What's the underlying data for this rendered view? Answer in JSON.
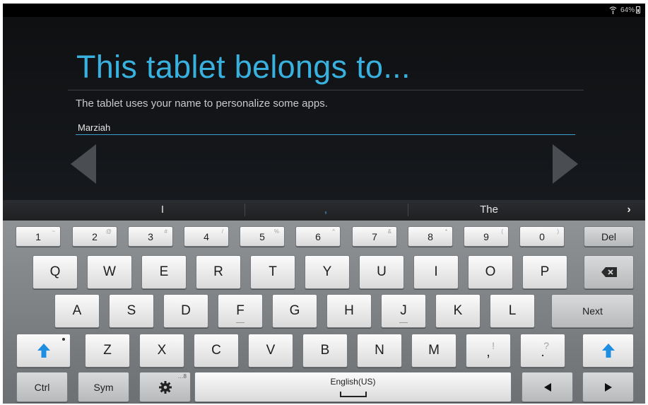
{
  "status_bar": {
    "battery_text": "64%",
    "signal_icon": "wifi-icon",
    "battery_icon": "battery-icon"
  },
  "setup": {
    "title": "This tablet belongs to...",
    "subtitle": "The tablet uses your name to personalize some apps.",
    "name_value": "Marziah",
    "prev_icon": "triangle-left-icon",
    "next_icon": "triangle-right-icon"
  },
  "suggestions": {
    "items": [
      "I",
      ",",
      "The"
    ],
    "more_label": "›"
  },
  "keyboard": {
    "row_numbers": [
      {
        "main": "1",
        "alt": "~"
      },
      {
        "main": "2",
        "alt": "@"
      },
      {
        "main": "3",
        "alt": "#"
      },
      {
        "main": "4",
        "alt": "/"
      },
      {
        "main": "5",
        "alt": "%"
      },
      {
        "main": "6",
        "alt": "^"
      },
      {
        "main": "7",
        "alt": "&"
      },
      {
        "main": "8",
        "alt": "*"
      },
      {
        "main": "9",
        "alt": "("
      },
      {
        "main": "0",
        "alt": ")"
      }
    ],
    "del_label": "Del",
    "row1": [
      "Q",
      "W",
      "E",
      "R",
      "T",
      "Y",
      "U",
      "I",
      "O",
      "P"
    ],
    "row2": [
      "A",
      "S",
      "D",
      "F",
      "G",
      "H",
      "J",
      "K",
      "L"
    ],
    "next_label": "Next",
    "row3": [
      "Z",
      "X",
      "C",
      "V",
      "B",
      "N",
      "M"
    ],
    "comma": {
      "main": ",",
      "alt": "!"
    },
    "period": {
      "main": ".",
      "alt": "?"
    },
    "ctrl_label": "Ctrl",
    "sym_label": "Sym",
    "settings_alt": "…8",
    "space_label": "English(US)",
    "accent_color": "#1e8fe0",
    "icons": {
      "backspace": "backspace-icon",
      "shift": "shift-arrow-icon",
      "settings": "gear-icon",
      "space": "space-bar-icon",
      "left": "cursor-left-icon",
      "right": "cursor-right-icon"
    }
  }
}
